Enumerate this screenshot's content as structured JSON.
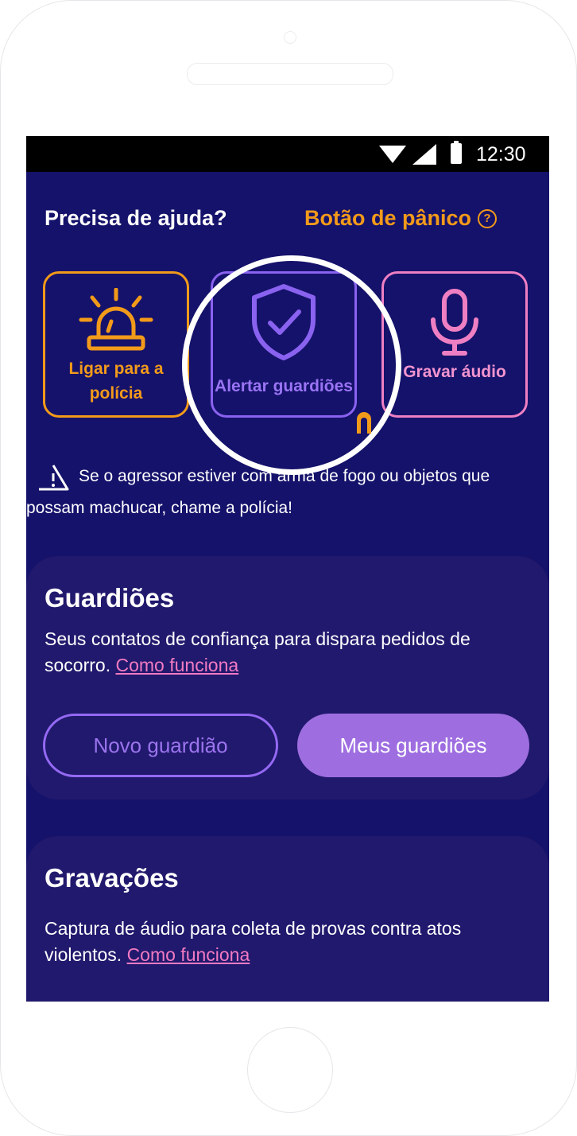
{
  "status_bar": {
    "time": "12:30",
    "icons": [
      "wifi-icon",
      "signal-icon",
      "battery-icon"
    ]
  },
  "header": {
    "title": "Precisa de ajuda?",
    "panic_label": "Botão de pânico",
    "panic_help_glyph": "?"
  },
  "actions": [
    {
      "label": "Ligar para a polícia",
      "icon": "siren-icon",
      "color": "#f29a1a"
    },
    {
      "label": "Alertar guardiões",
      "icon": "shield-check-icon",
      "color": "#8a62f0"
    },
    {
      "label": "Gravar áudio",
      "icon": "microphone-icon",
      "color": "#ef7fc3"
    }
  ],
  "warning": {
    "icon": "warning-triangle-icon",
    "text": "Se o agressor estiver com arma de fogo ou objetos que possam machucar, chame a polícia!"
  },
  "guardians": {
    "title": "Guardiões",
    "description": "Seus contatos de confiança para dispara pedidos de socorro.",
    "link": "Como funciona",
    "new_button": "Novo guardião",
    "my_button": "Meus guardiões"
  },
  "recordings": {
    "title": "Gravações",
    "description": "Captura de áudio para coleta de provas contra atos violentos.",
    "link": "Como funciona"
  },
  "colors": {
    "background": "#15126b",
    "section": "#21196d",
    "orange": "#f29a1a",
    "purple": "#8a62f0",
    "pink": "#ef7fc3"
  }
}
